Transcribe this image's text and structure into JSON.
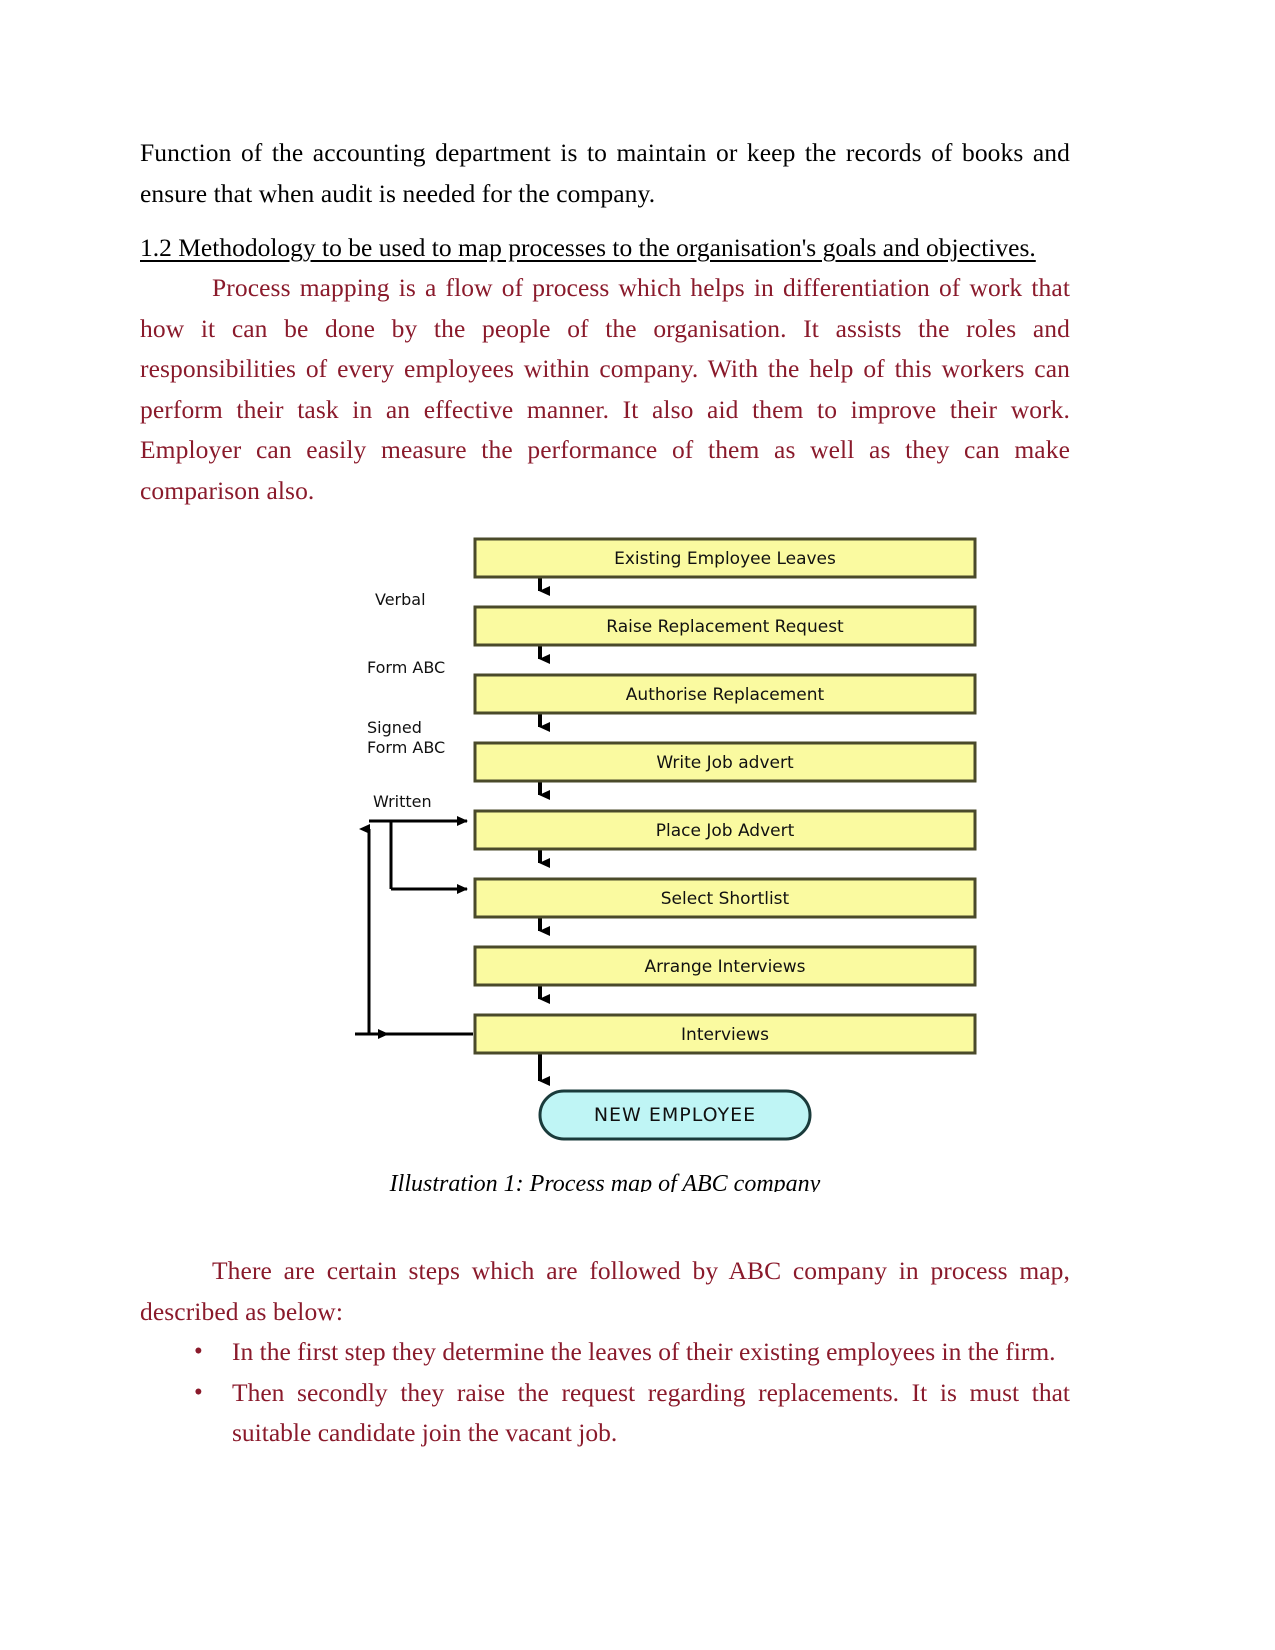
{
  "document": {
    "intro_paragraph": "Function of the accounting department is to maintain or keep the records of books and ensure that when audit is needed for the company.",
    "section_heading": "1.2 Methodology to be used to map processes to the organisation's goals and objectives.",
    "methodology_paragraph": "Process mapping is a flow of process which helps in differentiation of work that how it can be done by the people of the organisation. It assists the roles and responsibilities of every employees within company. With the help of this workers can perform their task in an effective manner. It also aid them to improve their work. Employer can easily measure the performance of them as well as they can make comparison also.",
    "figure_caption": "Illustration 1: Process map of ABC company",
    "steps_intro": "There are certain steps which are followed by ABC company in process map, described as below:",
    "bullets": [
      "In the first step they determine the leaves of their existing employees in the firm.",
      "Then secondly they raise the request regarding replacements. It is must that suitable candidate join the vacant job."
    ],
    "bullet_marker": "•"
  },
  "figure": {
    "title": "Process map of ABC company",
    "colors": {
      "process_fill": "#FAFAA0",
      "process_stroke": "#4a4a2a",
      "terminator_fill": "#BFF5F5",
      "terminator_stroke": "#1a3b3b",
      "connector": "#000000"
    },
    "process_steps": [
      "Existing Employee Leaves",
      "Raise Replacement Request",
      "Authorise Replacement",
      "Write Job advert",
      "Place Job Advert",
      "Select Shortlist",
      "Arrange Interviews",
      "Interviews"
    ],
    "terminator": "NEW EMPLOYEE",
    "side_labels": [
      "Verbal",
      "Form  ABC",
      "Signed",
      "Form ABC",
      "Written"
    ],
    "side_label_groups": [
      {
        "lines": [
          "Verbal"
        ]
      },
      {
        "lines": [
          "Form  ABC"
        ]
      },
      {
        "lines": [
          "Signed",
          "Form ABC"
        ]
      },
      {
        "lines": [
          "Written"
        ]
      }
    ],
    "feedback_loops": [
      {
        "from": "Interviews",
        "to": "Place Job Advert"
      },
      {
        "from": "Interviews",
        "to": "Select Shortlist"
      }
    ]
  }
}
